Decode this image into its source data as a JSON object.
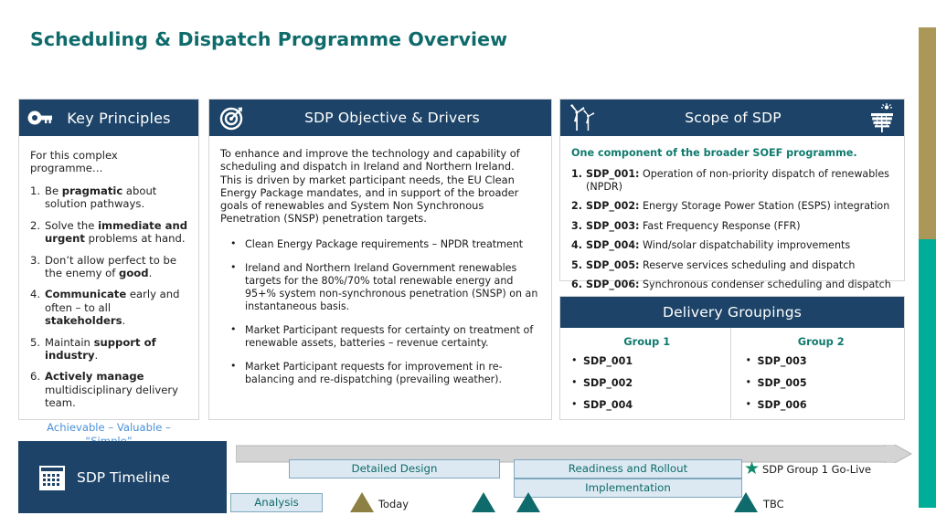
{
  "page": {
    "title": "Scheduling & Dispatch Programme Overview",
    "title_color": "#0f6b6b",
    "accent_tan": "#ab9758",
    "accent_teal": "#00ad98",
    "header_bg": "#1d4468"
  },
  "key_principles": {
    "header": "Key Principles",
    "icon": "key-icon",
    "intro": "For this complex programme…",
    "items": [
      {
        "lead": "Be ",
        "bold": "pragmatic",
        "rest": " about solution pathways."
      },
      {
        "lead": "Solve the ",
        "bold": "immediate and urgent",
        "rest": " problems at hand."
      },
      {
        "lead": "Don’t allow perfect to be the enemy of ",
        "bold": "good",
        "rest": "."
      },
      {
        "lead": "",
        "bold": "Communicate",
        "rest": " early and often – to all ",
        "bold2": "stakeholders",
        "rest2": "."
      },
      {
        "lead": "Maintain ",
        "bold": "support of industry",
        "rest": "."
      },
      {
        "lead": "",
        "bold": "Actively manage",
        "rest": " multidisciplinary delivery team."
      }
    ],
    "footer_line1": "Achievable – Valuable –",
    "footer_line2": "“Simple”",
    "footer_color": "#4a90d9"
  },
  "objective": {
    "header": "SDP Objective & Drivers",
    "icon": "target-icon",
    "paragraph": "To enhance and improve the technology and capability of scheduling and dispatch in Ireland and Northern Ireland.  This is driven by market participant needs, the EU Clean Energy Package mandates, and in support of the broader goals of renewables and System Non Synchronous Penetration (SNSP) penetration targets.",
    "bullets": [
      "Clean Energy Package requirements – NPDR treatment",
      "Ireland and Northern Ireland Government renewables targets for the 80%/70% total renewable energy and 95+% system non-synchronous penetration (SNSP) on an instantaneous basis.",
      "Market Participant requests for certainty on treatment of renewable assets, batteries – revenue certainty.",
      "Market Participant requests for improvement in re-balancing and re-dispatching (prevailing weather)."
    ]
  },
  "scope": {
    "header": "Scope of SDP",
    "icon_left": "wind-turbine-icon",
    "icon_right": "solar-panel-icon",
    "lead": "One component of the broader SOEF programme.",
    "lead_color": "#0f7a6e",
    "items": [
      {
        "id": "SDP_001:",
        "text": " Operation of non-priority dispatch of renewables (NPDR)"
      },
      {
        "id": "SDP_002:",
        "text": " Energy Storage Power Station (ESPS) integration"
      },
      {
        "id": "SDP_003:",
        "text": " Fast Frequency Response (FFR)"
      },
      {
        "id": "SDP_004:",
        "text": " Wind/solar dispatchability improvements"
      },
      {
        "id": "SDP_005:",
        "text": " Reserve services scheduling and dispatch"
      },
      {
        "id": "SDP_006:",
        "text": " Synchronous condenser scheduling and dispatch"
      }
    ]
  },
  "delivery": {
    "header": "Delivery Groupings",
    "group1": {
      "title": "Group 1",
      "items": [
        "SDP_001",
        "SDP_002",
        "SDP_004"
      ]
    },
    "group2": {
      "title": "Group 2",
      "items": [
        "SDP_003",
        "SDP_005",
        "SDP_006"
      ]
    }
  },
  "timeline": {
    "label": "SDP Timeline",
    "icon": "calendar-icon",
    "bars": {
      "analysis": "Analysis",
      "detailed_design": "Detailed Design",
      "readiness": "Readiness and Rollout",
      "implementation": "Implementation"
    },
    "markers": {
      "today": "Today",
      "tbc": "TBC",
      "go_live": "SDP Group 1 Go-Live",
      "star_icon": "star-icon"
    }
  }
}
